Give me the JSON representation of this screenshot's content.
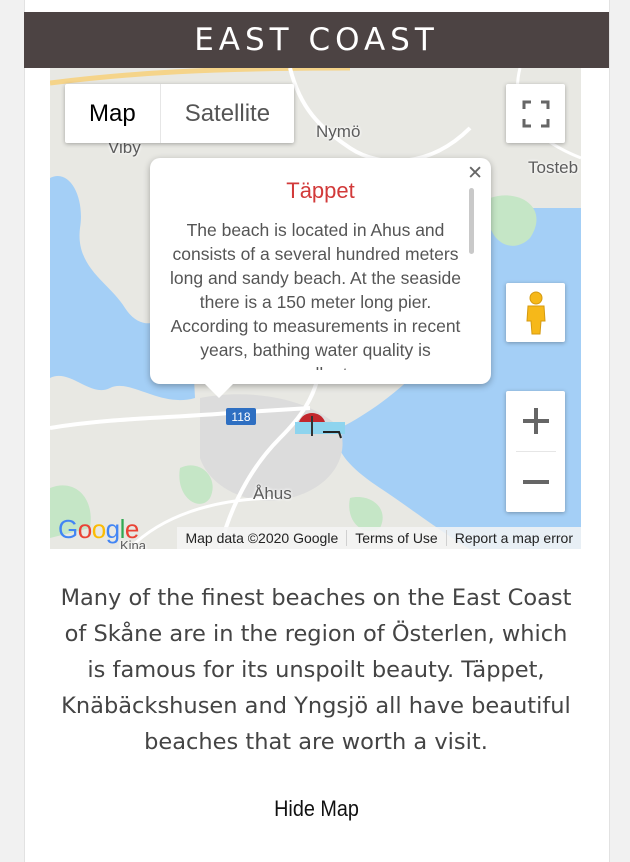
{
  "banner": {
    "title": "EAST COAST"
  },
  "map": {
    "type_control": {
      "map_label": "Map",
      "satellite_label": "Satellite"
    },
    "place_labels": {
      "nymo": "Nymö",
      "viby": "Viby",
      "tosteb": "Tosteb",
      "ahus": "Åhus",
      "road_118": "118",
      "kina": "Kina"
    },
    "infowindow": {
      "title": "Täppet",
      "body": "The beach is located in Ahus and consists of a several hundred meters long and sandy beach. At the seaside there is a 150 meter long pier. According to measurements in recent years, bathing water quality is excellent.",
      "close_icon": "close-icon"
    },
    "logo": "Google",
    "attribution": {
      "data": "Map data ©2020 Google",
      "terms": "Terms of Use",
      "report": "Report a map error"
    },
    "colors": {
      "water": "#a4cff6",
      "land": "#e8e8e3",
      "green": "#c5e6c6",
      "road": "#ffffff",
      "town": "#d8d8d8"
    }
  },
  "description": "Many of the finest beaches on the East Coast of Skåne are in the region of Österlen, which is famous for its unspoilt beauty. Täppet, Knäbäckshusen and Yngsjö all have beautiful beaches that are worth a visit.",
  "hide_map_label": "Hide Map"
}
